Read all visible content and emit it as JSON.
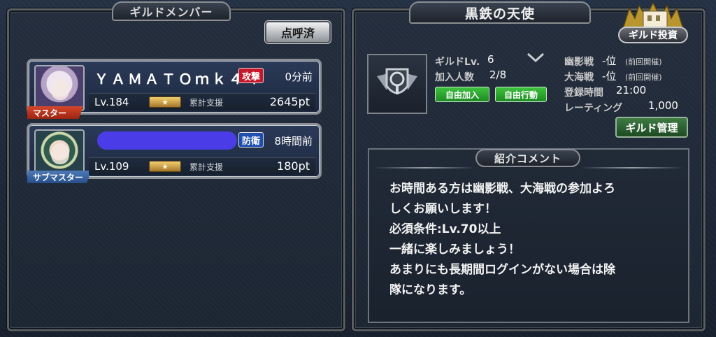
{
  "left_panel": {
    "title": "ギルドメンバー",
    "roll_call_button": "点呼済",
    "members": [
      {
        "role": "マスター",
        "name": "ＹＡＭＡＴＯｍｋ４４",
        "badge": "攻撃",
        "last_login": "0分前",
        "level": "Lv.184",
        "support_label": "累計支援",
        "support_value": "2645pt"
      },
      {
        "role": "サブマスター",
        "name": "",
        "badge": "防衛",
        "last_login": "8時間前",
        "level": "Lv.109",
        "support_label": "累計支援",
        "support_value": "180pt"
      }
    ]
  },
  "guild": {
    "name": "黒鉄の天使",
    "invest_button": "ギルド投資",
    "level_label": "ギルドLv.",
    "level_value": "6",
    "members_label": "加入人数",
    "members_value": "2/8",
    "join_button": "自由加入",
    "action_button": "自由行動",
    "ghost_war_label": "幽影戦",
    "ghost_war_value": "-位",
    "ghost_war_note": "(前回開催)",
    "sea_war_label": "大海戦",
    "sea_war_value": "-位",
    "sea_war_note": "(前回開催)",
    "register_label": "登録時間",
    "register_value": "21:00",
    "rating_label": "レーティング",
    "rating_value": "1,000",
    "manage_button": "ギルド管理"
  },
  "comment": {
    "title": "紹介コメント",
    "lines": [
      "お時間ある方は幽影戦、大海戦の参加よろ",
      "しくお願いします！",
      "必須条件:Lv.70以上",
      "一緒に楽しみましょう！",
      "あまりにも長期間ログインがない場合は除",
      "隊になります。"
    ]
  }
}
